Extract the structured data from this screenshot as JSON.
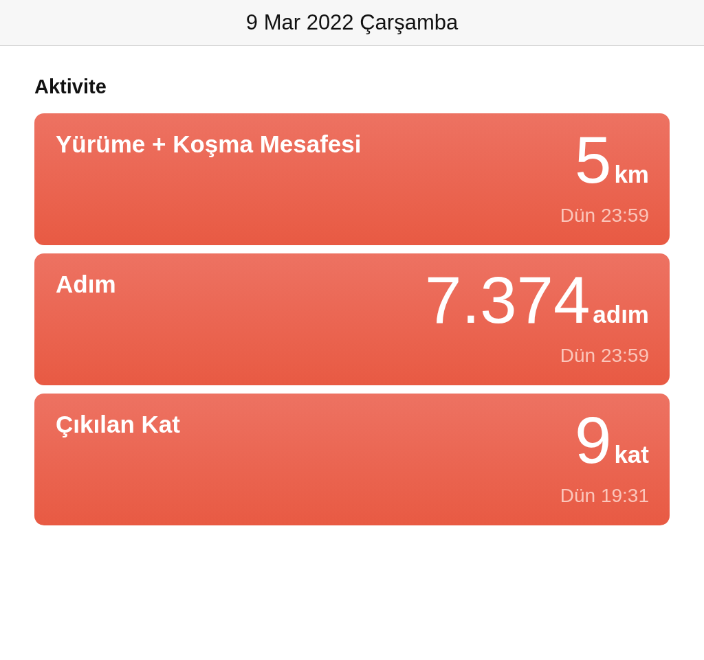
{
  "header": {
    "title": "9 Mar 2022 Çarşamba"
  },
  "section": {
    "title": "Aktivite"
  },
  "cards": [
    {
      "title": "Yürüme + Koşma Mesafesi",
      "value": "5",
      "unit": "km",
      "time": "Dün 23:59"
    },
    {
      "title": "Adım",
      "value": "7.374",
      "unit": "adım",
      "time": "Dün 23:59"
    },
    {
      "title": "Çıkılan Kat",
      "value": "9",
      "unit": "kat",
      "time": "Dün 19:31"
    }
  ]
}
